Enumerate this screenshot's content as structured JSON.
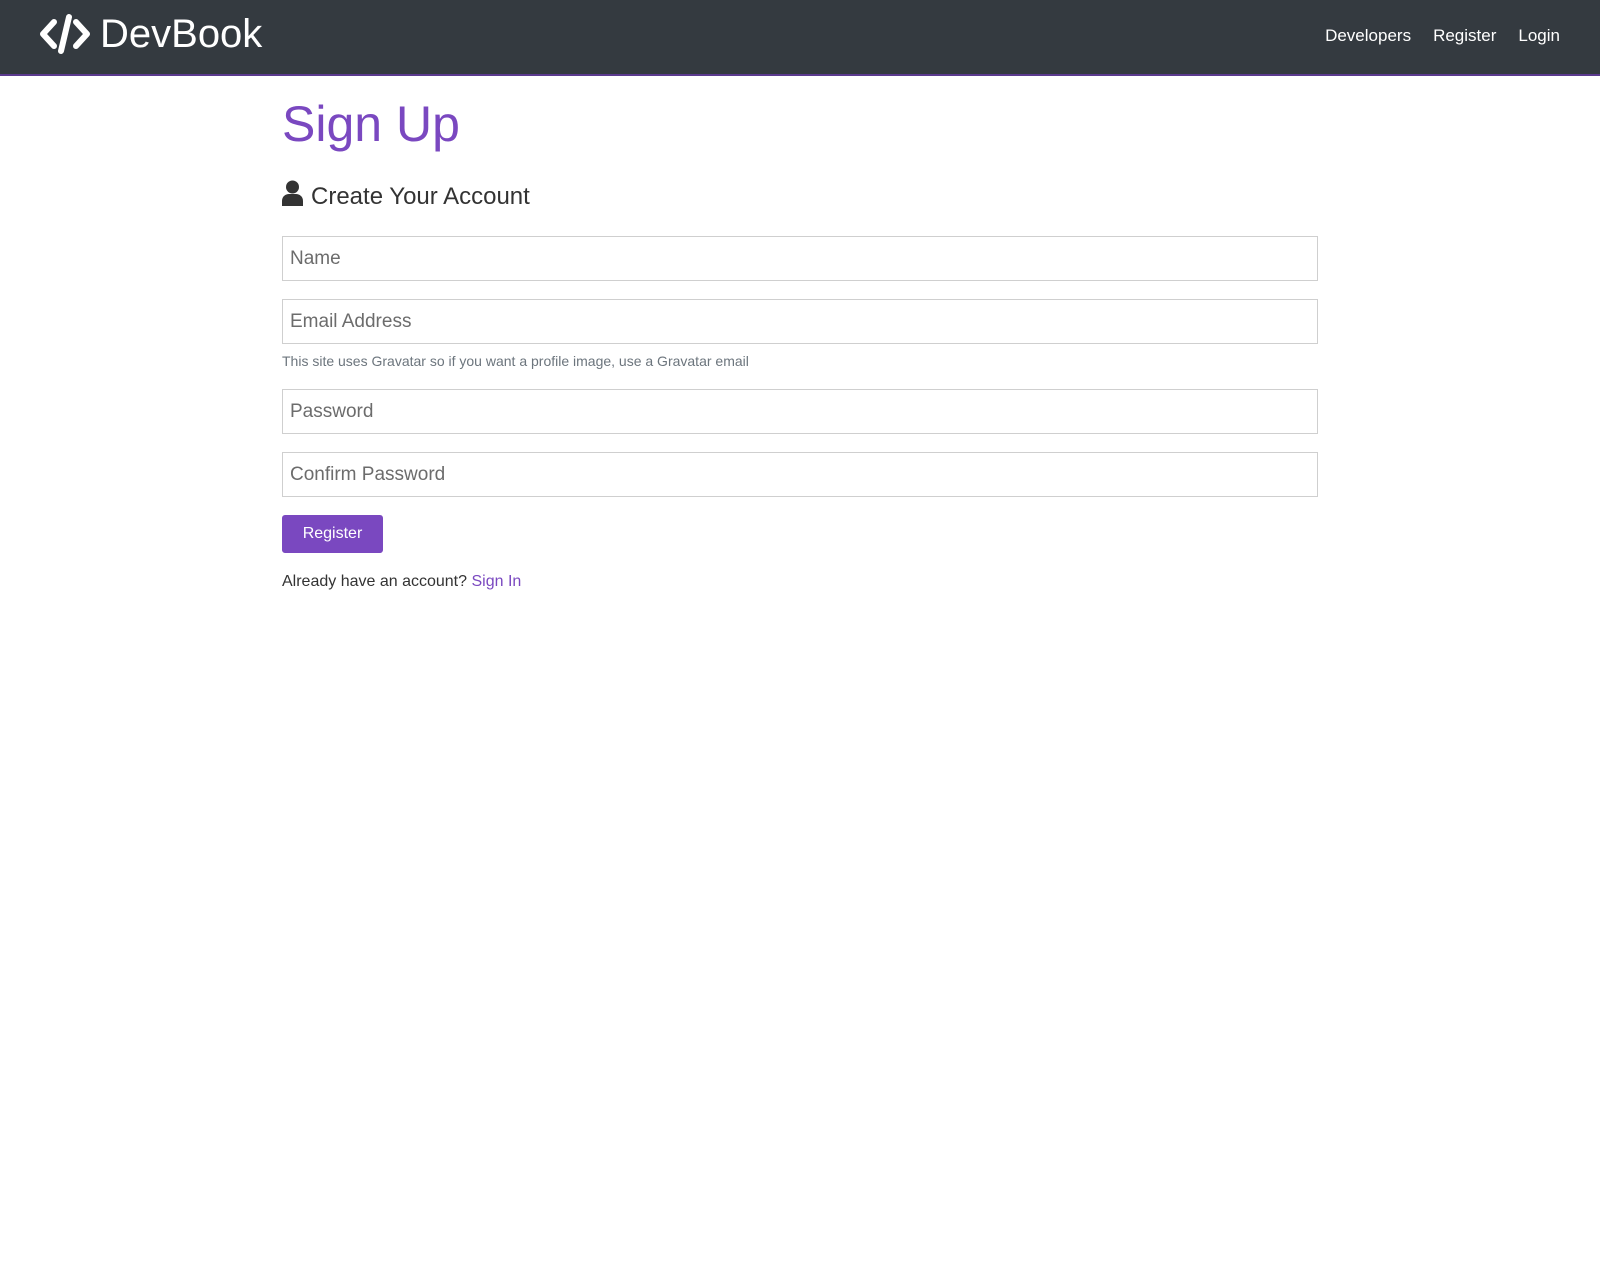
{
  "navbar": {
    "brand": "DevBook",
    "links": [
      "Developers",
      "Register",
      "Login"
    ]
  },
  "page": {
    "title": "Sign Up",
    "lead": "Create Your Account"
  },
  "form": {
    "name_placeholder": "Name",
    "email_placeholder": "Email Address",
    "email_help": "This site uses Gravatar so if you want a profile image, use a Gravatar email",
    "password_placeholder": "Password",
    "confirm_password_placeholder": "Confirm Password",
    "submit_label": "Register"
  },
  "footer": {
    "prompt": "Already have an account?",
    "link": "Sign In"
  },
  "colors": {
    "navbar_bg": "#343a40",
    "accent": "#7a48c0"
  },
  "icons": {
    "brand": "code-icon",
    "lead": "user-icon"
  }
}
